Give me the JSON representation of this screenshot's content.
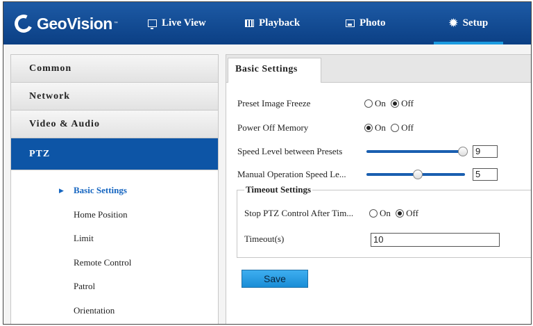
{
  "brand": {
    "name": "GeoVision",
    "colors": {
      "topbar": "#0b3f84",
      "accent": "#1b9be0",
      "active_sidebar": "#0d55a6",
      "save_button": "#1a8dd6"
    }
  },
  "nav": [
    {
      "label": "Live View",
      "icon": "monitor-icon"
    },
    {
      "label": "Playback",
      "icon": "film-icon"
    },
    {
      "label": "Photo",
      "icon": "photo-icon"
    },
    {
      "label": "Setup",
      "icon": "gear-icon",
      "active": true
    }
  ],
  "sidebar": {
    "items": [
      {
        "label": "Common"
      },
      {
        "label": "Network"
      },
      {
        "label": "Video & Audio"
      },
      {
        "label": "PTZ",
        "active": true
      }
    ],
    "subitems": [
      {
        "label": "Basic Settings",
        "active": true
      },
      {
        "label": "Home Position"
      },
      {
        "label": "Limit"
      },
      {
        "label": "Remote Control"
      },
      {
        "label": "Patrol"
      },
      {
        "label": "Orientation"
      }
    ]
  },
  "main": {
    "tab": "Basic Settings",
    "preset_image_freeze": {
      "label": "Preset Image Freeze",
      "on": "On",
      "off": "Off",
      "selected": "Off"
    },
    "power_off_memory": {
      "label": "Power Off Memory",
      "on": "On",
      "off": "Off",
      "selected": "On"
    },
    "speed_level": {
      "label": "Speed Level between Presets",
      "value": "9",
      "level_fraction": 0.98
    },
    "manual_speed": {
      "label": "Manual Operation Speed Le...",
      "value": "5",
      "level_fraction": 0.52
    },
    "timeout_settings": {
      "legend": "Timeout Settings",
      "stop_ptz": {
        "label": "Stop PTZ Control After Tim...",
        "on": "On",
        "off": "Off",
        "selected": "Off"
      },
      "timeout": {
        "label": "Timeout(s)",
        "value": "10"
      }
    },
    "save_label": "Save"
  }
}
